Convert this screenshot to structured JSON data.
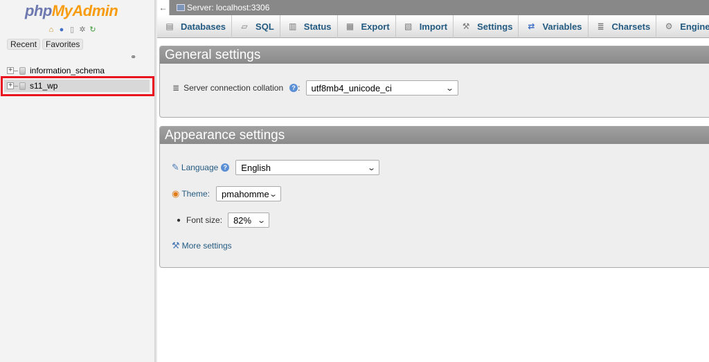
{
  "nav": {
    "logo_part1": "php",
    "logo_part2": "MyAdmin",
    "icons": [
      "home-icon",
      "help-icon",
      "docs-icon",
      "settings-icon",
      "reload-icon"
    ],
    "tabs": [
      "Recent",
      "Favorites"
    ],
    "databases": [
      {
        "name": "information_schema"
      },
      {
        "name": "s11_wp"
      }
    ]
  },
  "serverbar": {
    "back_glyph": "←",
    "server_label": "Server: localhost:3306"
  },
  "topmenu": {
    "tabs": [
      {
        "label": "Databases",
        "icon": "database-icon"
      },
      {
        "label": "SQL",
        "icon": "sql-icon"
      },
      {
        "label": "Status",
        "icon": "status-icon"
      },
      {
        "label": "Export",
        "icon": "export-icon"
      },
      {
        "label": "Import",
        "icon": "import-icon"
      },
      {
        "label": "Settings",
        "icon": "wrench-icon"
      },
      {
        "label": "Variables",
        "icon": "variables-icon"
      },
      {
        "label": "Charsets",
        "icon": "charsets-icon"
      },
      {
        "label": "Engines",
        "icon": "engines-icon"
      }
    ]
  },
  "general": {
    "title": "General settings",
    "collation_label": "Server connection collation",
    "collation_suffix": ":",
    "collation_value": "utf8mb4_unicode_ci"
  },
  "appearance": {
    "title": "Appearance settings",
    "language_label": "Language",
    "language_value": "English",
    "theme_label": "Theme:",
    "theme_value": "pmahomme",
    "fontsize_label": "Font size:",
    "fontsize_value": "82%",
    "more_settings": "More settings"
  },
  "colors": {
    "highlight_border": "#e8131f",
    "link": "#235a81",
    "panel_header": "#8a8a8a",
    "logo_php": "#6c78af",
    "logo_myadmin": "#f89c0e"
  }
}
